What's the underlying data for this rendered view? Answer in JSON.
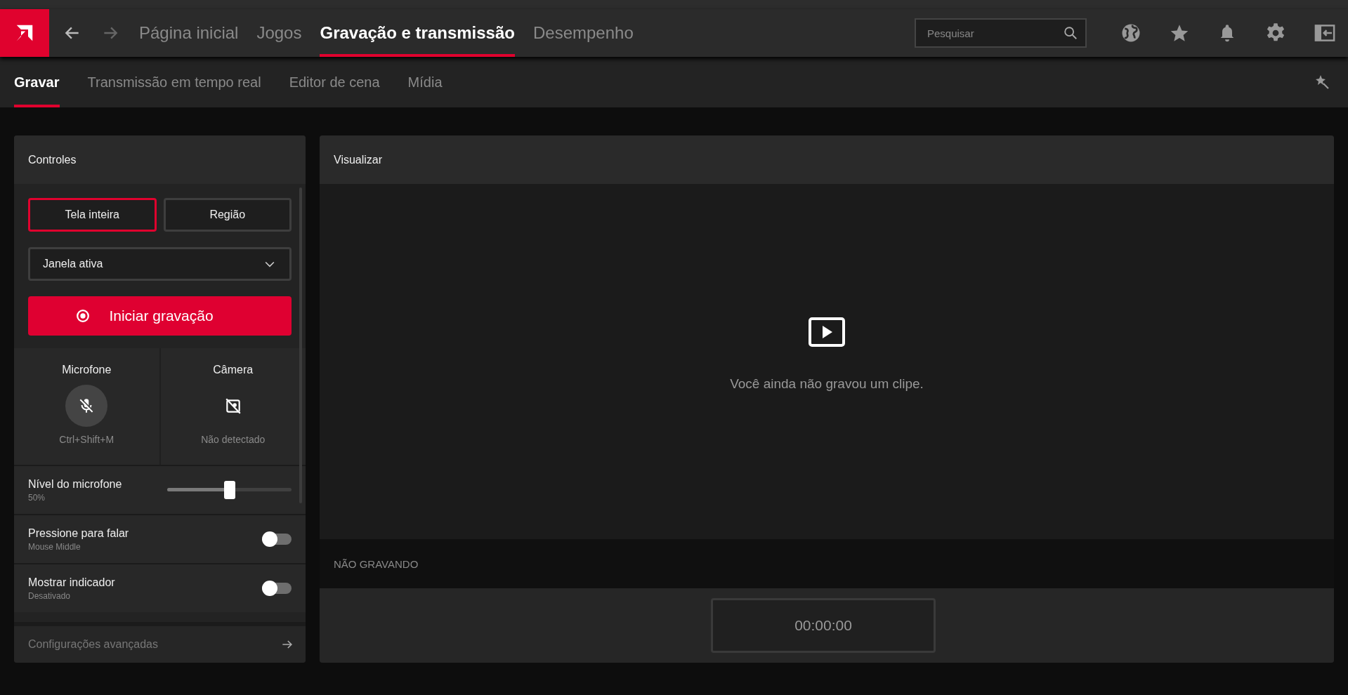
{
  "nav": {
    "tabs": [
      {
        "label": "Página inicial",
        "selected": false
      },
      {
        "label": "Jogos",
        "selected": false
      },
      {
        "label": "Gravação e transmissão",
        "selected": true
      },
      {
        "label": "Desempenho",
        "selected": false
      }
    ],
    "search": {
      "placeholder": "Pesquisar"
    }
  },
  "subnav": {
    "tabs": [
      {
        "label": "Gravar",
        "selected": true
      },
      {
        "label": "Transmissão em tempo real",
        "selected": false
      },
      {
        "label": "Editor de cena",
        "selected": false
      },
      {
        "label": "Mídia",
        "selected": false
      }
    ]
  },
  "controls": {
    "title": "Controles",
    "modes": [
      {
        "label": "Tela inteira",
        "selected": true
      },
      {
        "label": "Região",
        "selected": false
      }
    ],
    "dropdown": {
      "value": "Janela ativa"
    },
    "record_button": "Iniciar gravação",
    "microphone": {
      "label": "Microfone",
      "muted": true,
      "shortcut": "Ctrl+Shift+M"
    },
    "camera": {
      "label": "Câmera",
      "status": "Não detectado"
    },
    "mic_level": {
      "label": "Nível do microfone",
      "reading": "50%",
      "level": 0.5
    },
    "toggles": [
      {
        "label": "Pressione para falar",
        "sublabel": "Mouse Middle",
        "on": false
      },
      {
        "label": "Mostrar indicador",
        "sublabel": "Desativado",
        "on": false
      }
    ],
    "advanced": "Configurações avançadas"
  },
  "preview": {
    "title": "Visualizar",
    "empty_message": "Você ainda não gravou um clipe.",
    "status": "NÃO GRAVANDO",
    "timer": "00:00:00"
  }
}
